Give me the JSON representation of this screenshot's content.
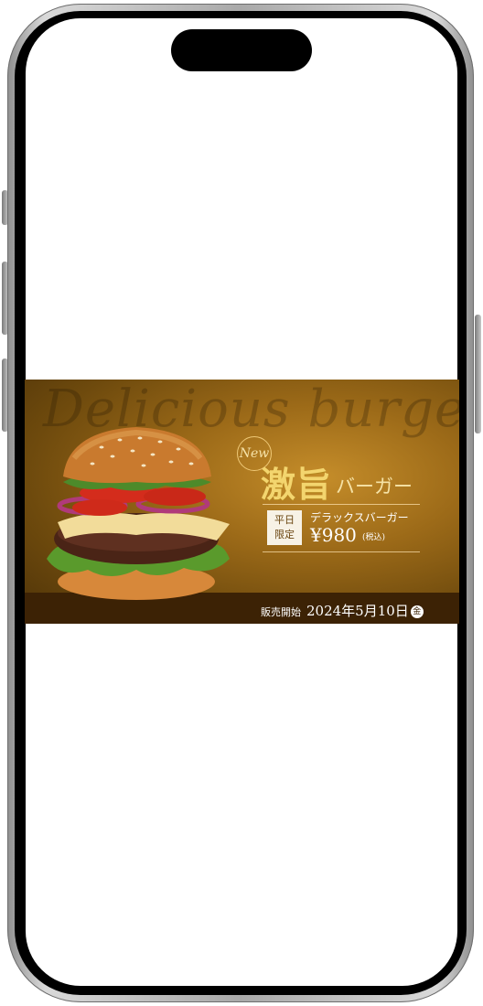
{
  "banner": {
    "background_script": "Delicious burger",
    "new_badge": "New",
    "title_main": "激旨",
    "title_sub": "バーガー",
    "weekday_line1": "平日",
    "weekday_line2": "限定",
    "product_name": "デラックスバーガー",
    "price": "¥980",
    "tax_note": "(税込)",
    "sale_label": "販売開始",
    "sale_date": "2024年5月10日",
    "sale_weekday": "金"
  },
  "colors": {
    "banner_gold": "#9c6a18",
    "title_gold": "#f3d56e",
    "footer_brown": "#3c2205"
  }
}
